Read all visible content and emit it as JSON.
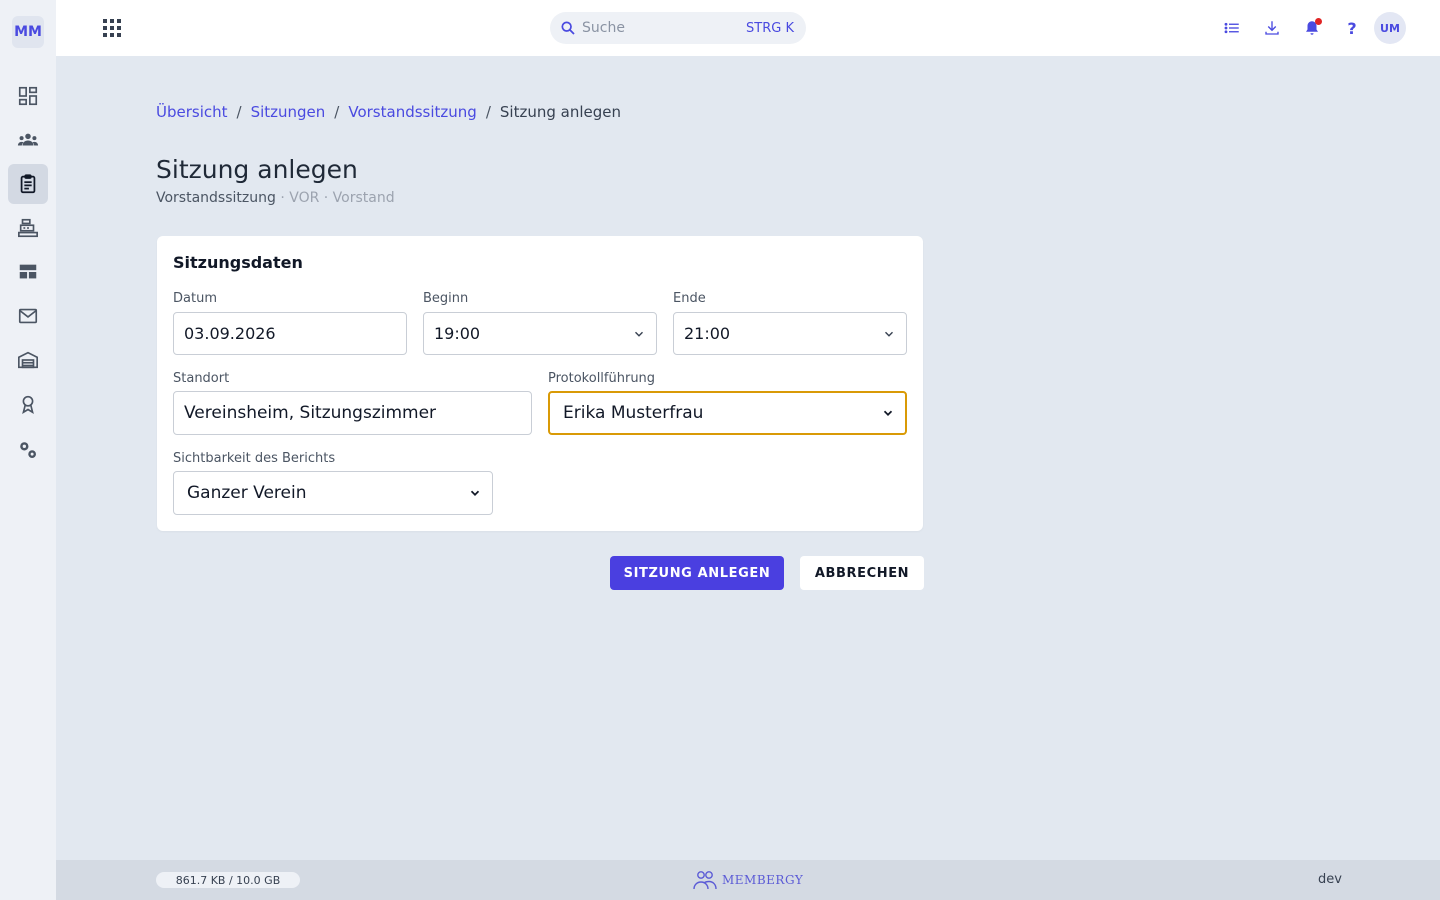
{
  "sidebar": {
    "logo": "MM",
    "items": [
      {
        "icon": "dashboard-icon"
      },
      {
        "icon": "members-icon"
      },
      {
        "icon": "clipboard-icon",
        "active": true
      },
      {
        "icon": "cash-register-icon"
      },
      {
        "icon": "layout-icon"
      },
      {
        "icon": "mail-icon"
      },
      {
        "icon": "warehouse-icon"
      },
      {
        "icon": "award-icon"
      },
      {
        "icon": "settings-icon"
      }
    ]
  },
  "topbar": {
    "search_placeholder": "Suche",
    "search_shortcut": "STRG K",
    "help": "?",
    "avatar": "UM"
  },
  "breadcrumb": {
    "items": [
      "Übersicht",
      "Sitzungen",
      "Vorstandssitzung"
    ],
    "separator": "/",
    "current": "Sitzung anlegen"
  },
  "page": {
    "title": "Sitzung anlegen",
    "subtitle_main": "Vorstandssitzung",
    "subtitle_meta": " · VOR · Vorstand"
  },
  "form": {
    "title": "Sitzungsdaten",
    "datum_label": "Datum",
    "datum_value": "03.09.2026",
    "beginn_label": "Beginn",
    "beginn_value": "19:00",
    "ende_label": "Ende",
    "ende_value": "21:00",
    "standort_label": "Standort",
    "standort_value": "Vereinsheim, Sitzungszimmer",
    "protokoll_label": "Protokollführung",
    "protokoll_value": "Erika Musterfrau",
    "sichtbarkeit_label": "Sichtbarkeit des Berichts",
    "sichtbarkeit_value": "Ganzer Verein"
  },
  "actions": {
    "submit": "SITZUNG ANLEGEN",
    "cancel": "ABBRECHEN"
  },
  "footer": {
    "storage": "861.7 KB / 10.0 GB",
    "brand": "MEMBERGY",
    "env": "dev"
  },
  "colors": {
    "accent": "#4a3fe0",
    "focus": "#d99a06",
    "notification": "#e02424"
  }
}
